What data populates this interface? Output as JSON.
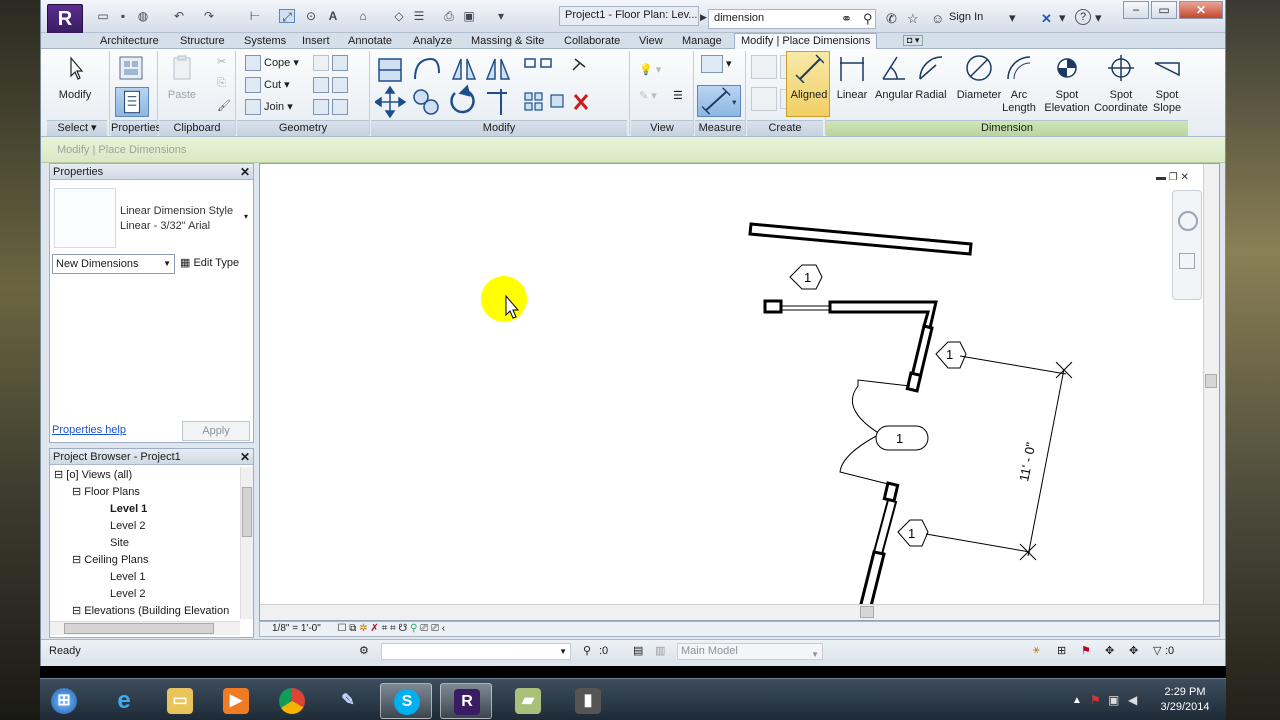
{
  "titlebar": {
    "logo_letter": "R",
    "doc_title": "Project1 - Floor Plan: Lev...",
    "search_value": "dimension",
    "sign_in": "Sign In",
    "help": "?"
  },
  "tabs": [
    "Architecture",
    "Structure",
    "Systems",
    "Insert",
    "Annotate",
    "Analyze",
    "Massing & Site",
    "Collaborate",
    "View",
    "Manage",
    "Modify | Place Dimensions"
  ],
  "ribbon": {
    "modify": {
      "label": "Modify"
    },
    "select_panel": "Select",
    "properties_panel": "Properties",
    "clipboard": {
      "paste": "Paste",
      "panel": "Clipboard"
    },
    "geometry": {
      "cope": "Cope",
      "cut": "Cut",
      "join": "Join",
      "panel": "Geometry"
    },
    "modify_panel": "Modify",
    "view_panel": "View",
    "measure_panel": "Measure",
    "create_panel": "Create",
    "dimension_panel": "Dimension",
    "dimension_tools": [
      {
        "label": "Aligned",
        "icon": "aligned-dimension-icon"
      },
      {
        "label": "Linear",
        "icon": "linear-dimension-icon"
      },
      {
        "label": "Angular",
        "icon": "angular-dimension-icon"
      },
      {
        "label": "Radial",
        "icon": "radial-dimension-icon"
      },
      {
        "label": "Diameter",
        "icon": "diameter-dimension-icon"
      },
      {
        "label": "Arc\nLength",
        "icon": "arc-length-icon"
      },
      {
        "label": "Spot\nElevation",
        "icon": "spot-elevation-icon"
      },
      {
        "label": "Spot\nCoordinate",
        "icon": "spot-coordinate-icon"
      },
      {
        "label": "Spot\nSlope",
        "icon": "spot-slope-icon"
      }
    ]
  },
  "options_bar": "Modify | Place Dimensions",
  "properties": {
    "title": "Properties",
    "type_name": "Linear Dimension Style",
    "type_sub": "Linear - 3/32\" Arial",
    "instance_filter": "New Dimensions",
    "edit_type": "Edit Type",
    "help_link": "Properties help",
    "apply": "Apply"
  },
  "project_browser": {
    "title": "Project Browser - Project1",
    "views_all": "Views (all)",
    "floor_plans": "Floor Plans",
    "fp_level1": "Level 1",
    "fp_level2": "Level 2",
    "fp_site": "Site",
    "ceiling_plans": "Ceiling Plans",
    "cp_level1": "Level 1",
    "cp_level2": "Level 2",
    "elevations": "Elevations (Building Elevation"
  },
  "canvas": {
    "dimension_text": "11' - 0\"",
    "tag_top": "1",
    "tag_right_upper": "1",
    "tag_door": "1",
    "tag_right_lower": "1"
  },
  "view_control": {
    "scale": "1/8\" = 1'-0\""
  },
  "statusbar": {
    "status": "Ready",
    "count": ":0",
    "model": "Main Model",
    "filter_count": ":0"
  },
  "taskbar": {
    "time": "2:29 PM",
    "date": "3/29/2014"
  },
  "colors": {
    "active_tab": "#f4f7fb",
    "dimension_panel_bar": "#cfe6b8",
    "aligned_highlight": "#f0cf64",
    "cursor_highlight": "#ffff00"
  }
}
